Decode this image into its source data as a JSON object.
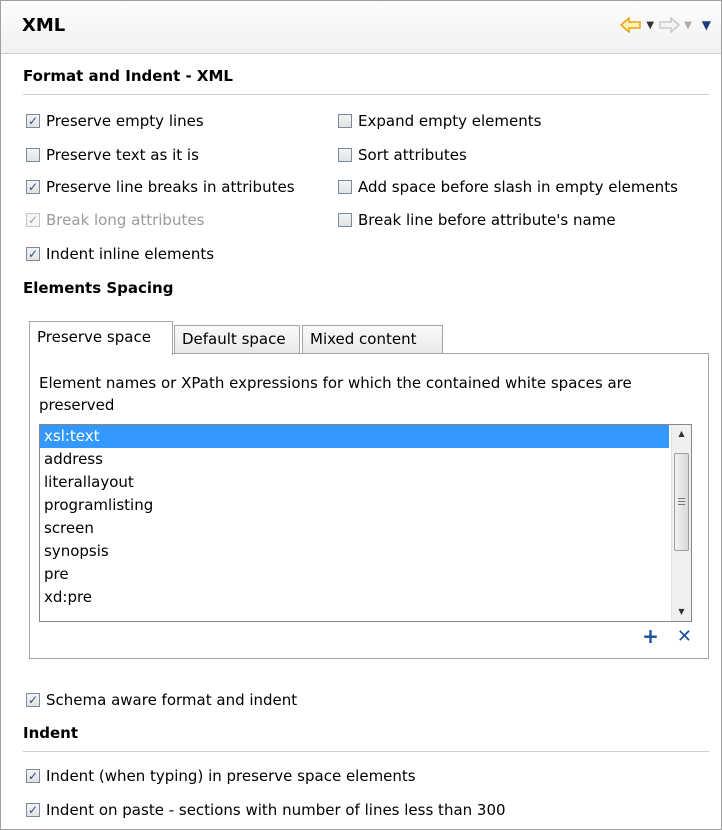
{
  "header": {
    "title": "XML"
  },
  "format_section": {
    "title": "Format and Indent - XML",
    "options_left": [
      {
        "label": "Preserve empty lines",
        "checked": true,
        "disabled": false
      },
      {
        "label": "Preserve text as it is",
        "checked": false,
        "disabled": false
      },
      {
        "label": "Preserve line breaks in attributes",
        "checked": true,
        "disabled": false
      },
      {
        "label": "Break long attributes",
        "checked": true,
        "disabled": true
      },
      {
        "label": "Indent inline elements",
        "checked": true,
        "disabled": false
      }
    ],
    "options_right": [
      {
        "label": "Expand empty elements",
        "checked": false,
        "disabled": false
      },
      {
        "label": "Sort attributes",
        "checked": false,
        "disabled": false
      },
      {
        "label": "Add space before slash in empty elements",
        "checked": false,
        "disabled": false
      },
      {
        "label": "Break line before attribute's name",
        "checked": false,
        "disabled": false
      }
    ]
  },
  "spacing_section": {
    "title": "Elements Spacing",
    "tabs": [
      {
        "label": "Preserve space",
        "active": true
      },
      {
        "label": "Default space",
        "active": false
      },
      {
        "label": "Mixed content",
        "active": false
      }
    ],
    "description": "Element names or XPath expressions for which the contained white spaces are preserved",
    "items": [
      "xsl:text",
      "address",
      "literallayout",
      "programlisting",
      "screen",
      "synopsis",
      "pre",
      "xd:pre"
    ],
    "selected_index": 0,
    "add_label": "+",
    "remove_label": "✕"
  },
  "schema_option": {
    "label": "Schema aware format and indent",
    "checked": true
  },
  "indent_section": {
    "title": "Indent",
    "options": [
      {
        "label": "Indent (when typing) in preserve space elements",
        "checked": true
      },
      {
        "label": "Indent on paste - sections with number of lines less than 300",
        "checked": true
      }
    ]
  },
  "colors": {
    "selection": "#3399ff",
    "accent": "#1b4f9c",
    "nav_back": "#e8a317"
  }
}
